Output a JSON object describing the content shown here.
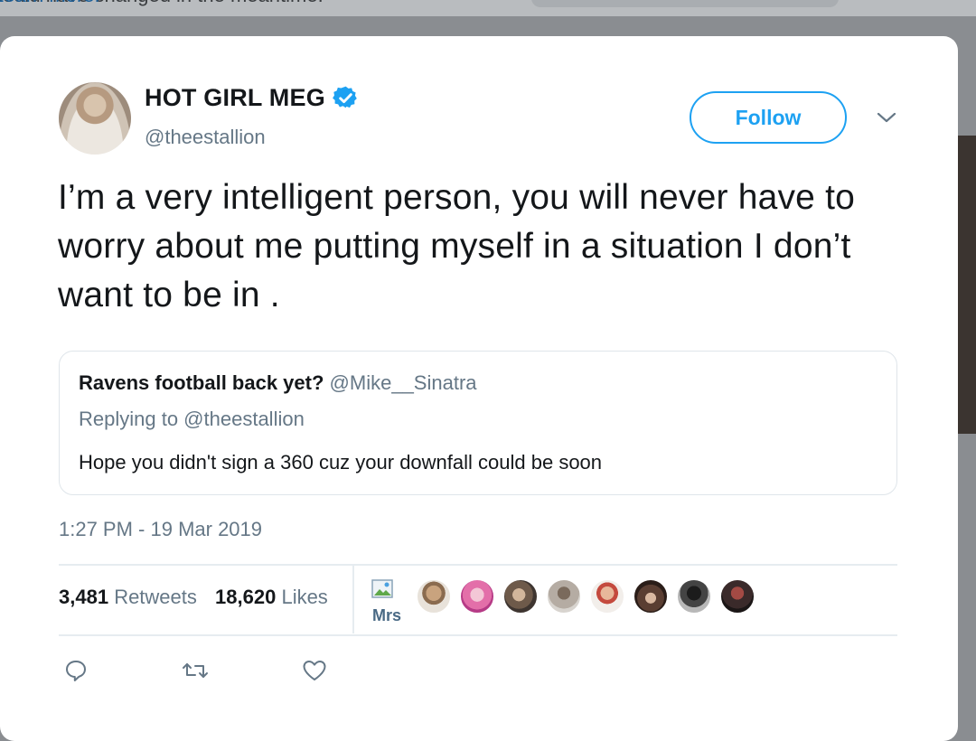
{
  "behind_page": {
    "notice_text": "could have changed in the meantime.",
    "learn_more": "Learn more."
  },
  "tweet": {
    "author_name": "HOT GIRL MEG",
    "author_handle": "@theestallion",
    "follow_label": "Follow",
    "text": "I’m a very intelligent person, you will never have to worry about me putting myself in a situation I don’t want to be in .",
    "timestamp": "1:27 PM - 19 Mar 2019",
    "retweets_count": "3,481",
    "retweets_label": "Retweets",
    "likes_count": "18,620",
    "likes_label": "Likes",
    "liker_alt_text": "Mrs"
  },
  "quoted_tweet": {
    "author_name": "Ravens football back yet?",
    "author_handle": "@Mike__Sinatra",
    "replying_label": "Replying to @theestallion",
    "text": "Hope you didn't sign a 360 cuz your downfall could be soon"
  },
  "colors": {
    "accent": "#1da1f2",
    "text_primary": "#14171a",
    "text_secondary": "#657786",
    "divider": "#e6ecf0"
  },
  "icons": {
    "verified": "verified-badge-icon",
    "menu": "chevron-down-icon",
    "reply": "reply-icon",
    "retweet": "retweet-icon",
    "like": "heart-icon"
  }
}
